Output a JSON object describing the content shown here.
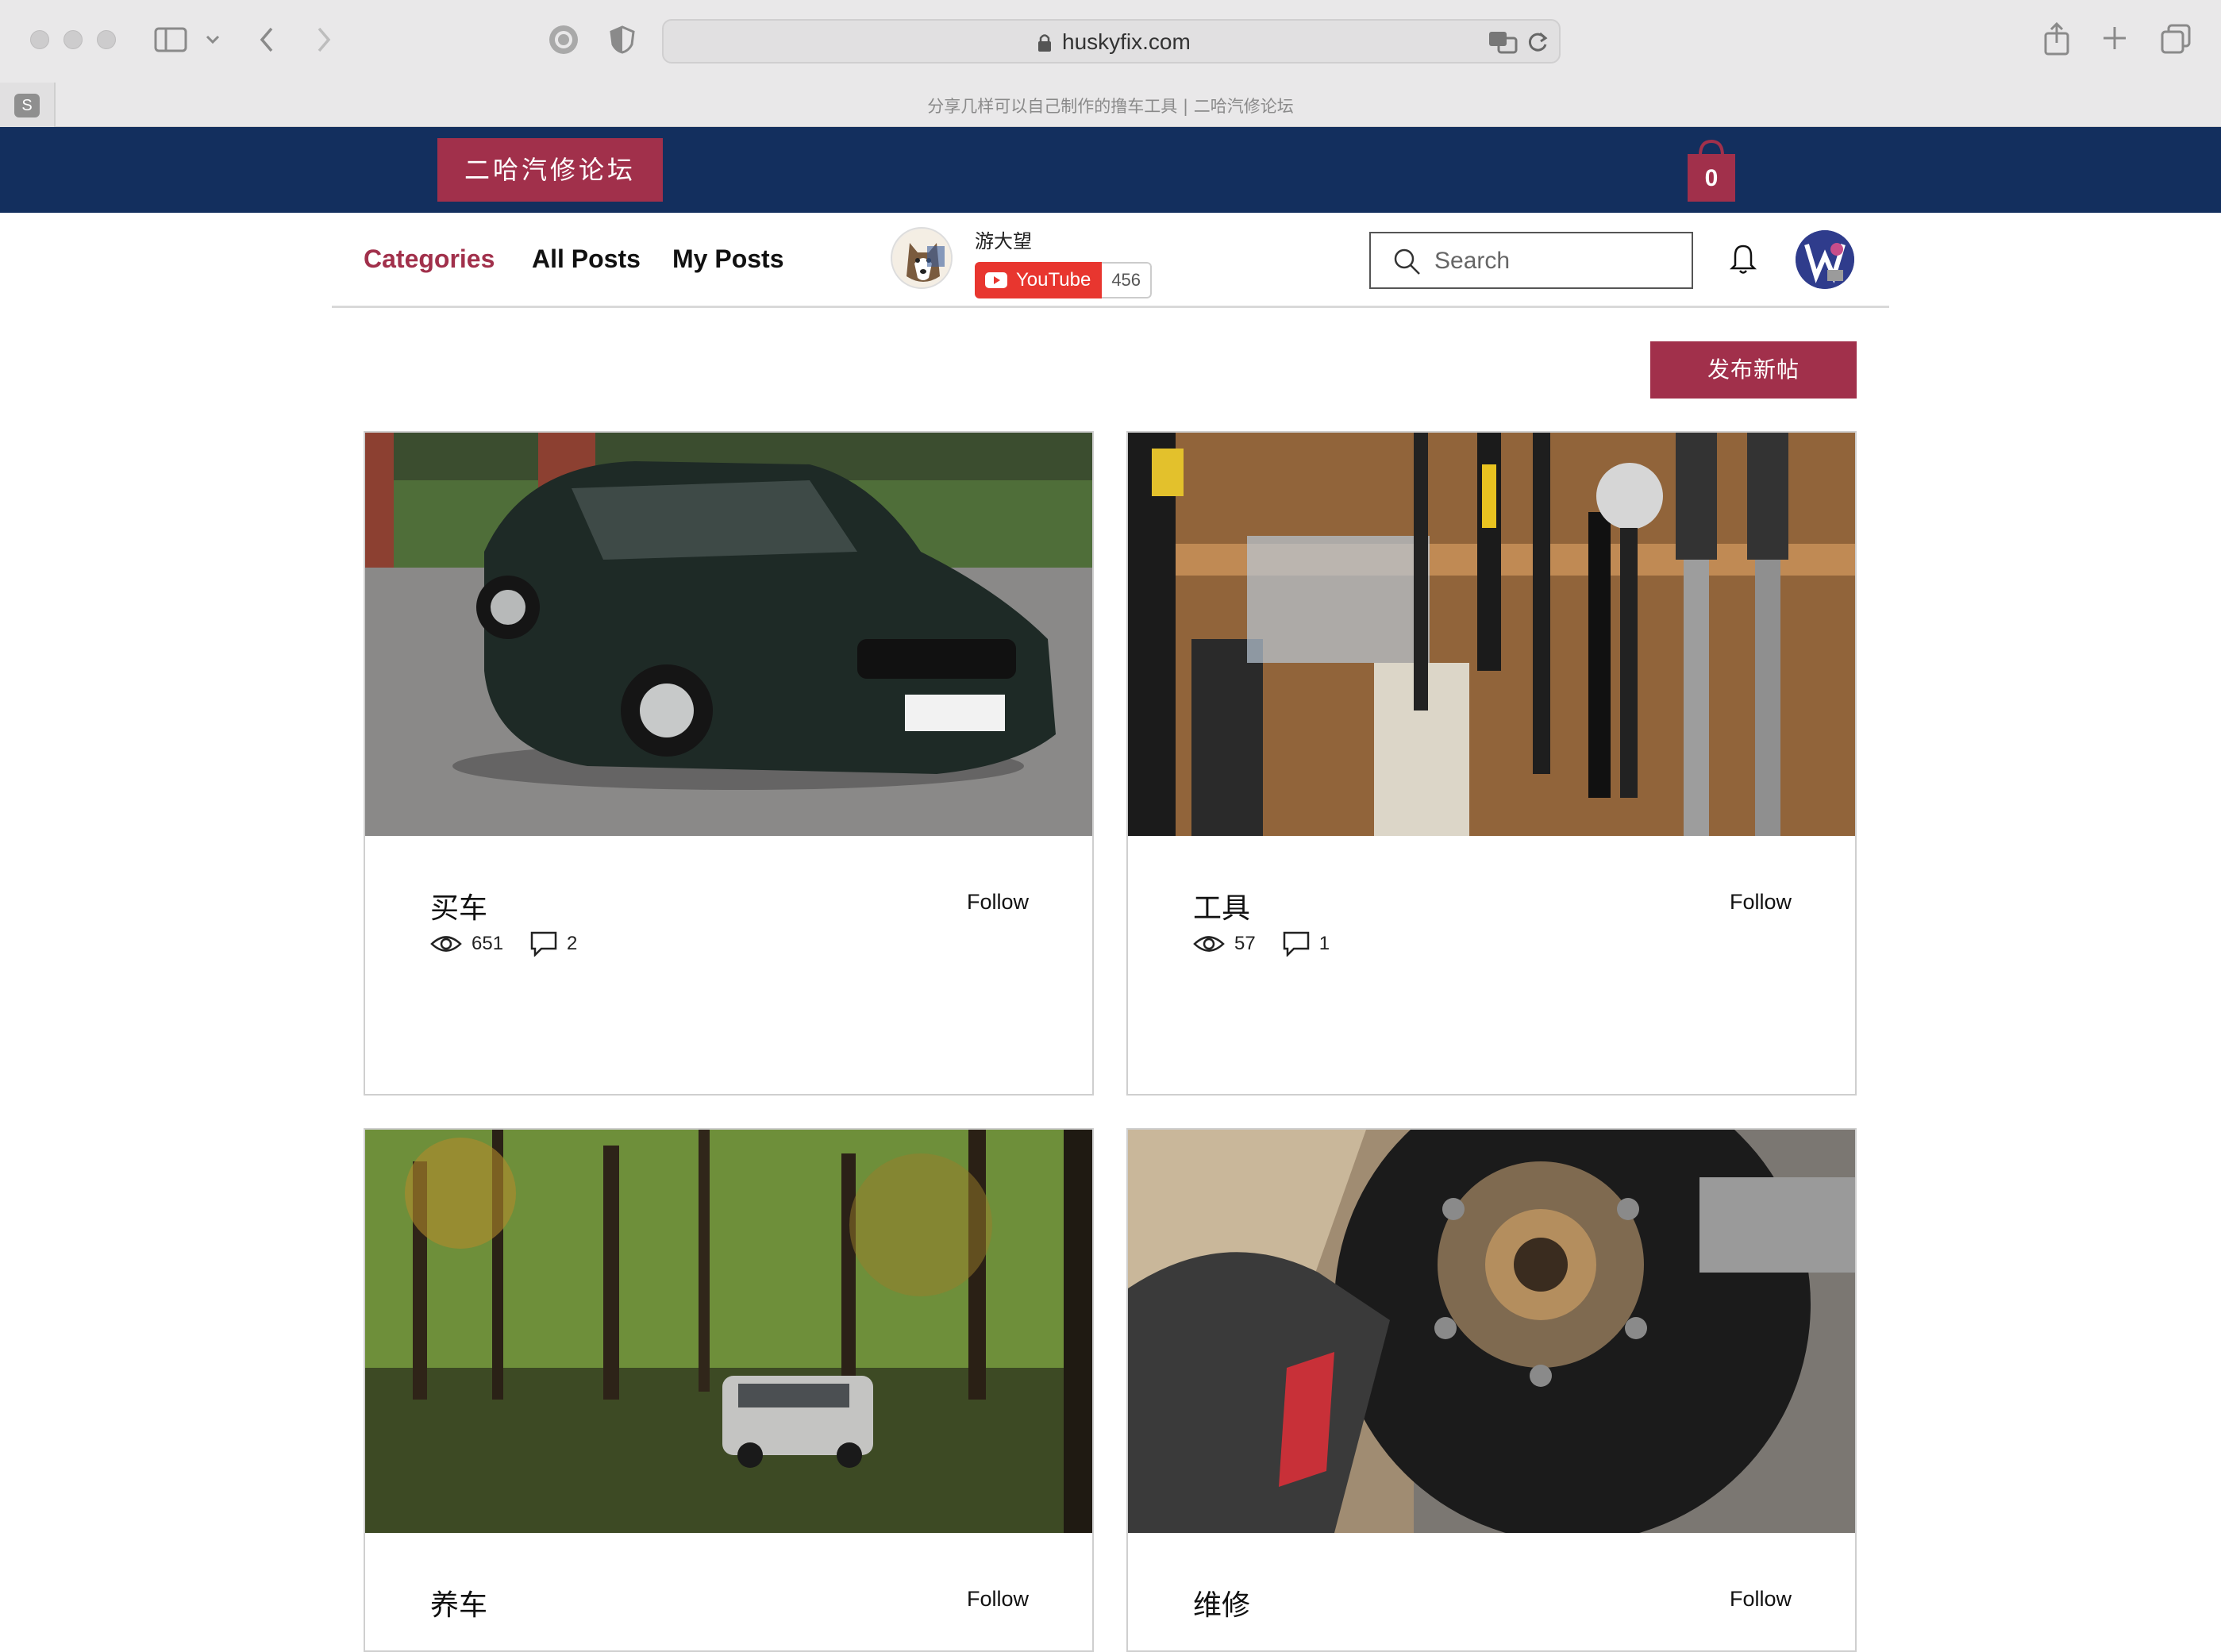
{
  "browser": {
    "url": "huskyfix.com",
    "tab_title": "分享几样可以自己制作的撸车工具 | 二哈汽修论坛",
    "tab_favicon": "S"
  },
  "header": {
    "logo": "二哈汽修论坛",
    "cart_count": "0",
    "colors": {
      "header_bg": "#132f5e",
      "accent": "#a1304b"
    }
  },
  "nav": {
    "categories": "Categories",
    "all_posts": "All Posts",
    "my_posts": "My Posts",
    "channel_name": "游大望",
    "youtube_label": "YouTube",
    "youtube_count": "456",
    "search_placeholder": "Search"
  },
  "main": {
    "new_post": "发布新帖",
    "categories": [
      {
        "title": "买车",
        "follow": "Follow",
        "views": "651",
        "comments": "2"
      },
      {
        "title": "工具",
        "follow": "Follow",
        "views": "57",
        "comments": "1"
      },
      {
        "title": "养车",
        "follow": "Follow"
      },
      {
        "title": "维修",
        "follow": "Follow"
      }
    ]
  }
}
